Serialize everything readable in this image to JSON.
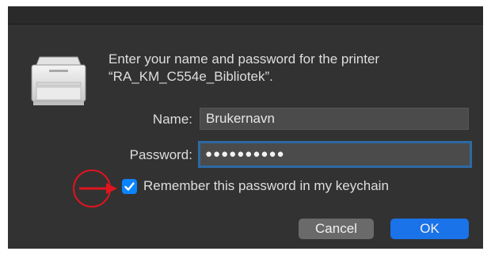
{
  "dialog": {
    "message_line1": "Enter your name and password for the printer",
    "message_line2": "“RA_KM_C554e_Bibliotek”."
  },
  "form": {
    "name_label": "Name:",
    "name_value": "Brukernavn",
    "password_label": "Password:",
    "password_masked": "●●●●●●●●●●",
    "remember_label": "Remember this password in my keychain",
    "remember_checked": true
  },
  "buttons": {
    "cancel_label": "Cancel",
    "ok_label": "OK"
  },
  "colors": {
    "accent": "#0a84ff",
    "default_button": "#1a73e8",
    "annotation_red": "#e0141e"
  },
  "icons": {
    "printer": "printer-icon",
    "checkmark": "checkmark-icon",
    "annotation": "red-arrow-annotation-icon"
  }
}
